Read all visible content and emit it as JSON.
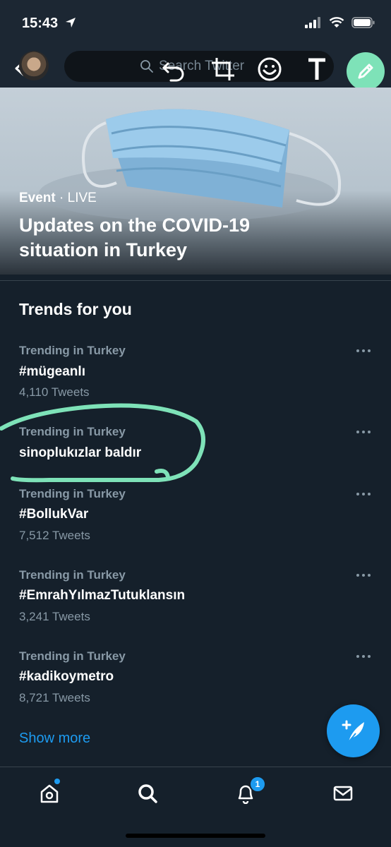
{
  "status_bar": {
    "time": "15:43"
  },
  "search": {
    "placeholder": "Search Twitter"
  },
  "hero": {
    "kicker_event": "Event",
    "kicker_separator": " · ",
    "kicker_live": "LIVE",
    "title": "Updates on the COVID-19 situation in Turkey"
  },
  "section": {
    "title": "Trends for you"
  },
  "trends": [
    {
      "meta": "Trending in Turkey",
      "name": "#mügeanlı",
      "count": "4,110 Tweets"
    },
    {
      "meta": "Trending in Turkey",
      "name": "sinoplukızlar baldır",
      "count": ""
    },
    {
      "meta": "Trending in Turkey",
      "name": "#BollukVar",
      "count": "7,512 Tweets"
    },
    {
      "meta": "Trending in Turkey",
      "name": "#EmrahYılmazTutuklansın",
      "count": "3,241 Tweets"
    },
    {
      "meta": "Trending in Turkey",
      "name": "#kadikoymetro",
      "count": "8,721 Tweets"
    }
  ],
  "show_more": "Show more",
  "tabbar": {
    "notifications_badge": "1"
  },
  "colors": {
    "background": "#15202b",
    "accent": "#1d9bf0",
    "annotation_green": "#7ee2b8"
  }
}
